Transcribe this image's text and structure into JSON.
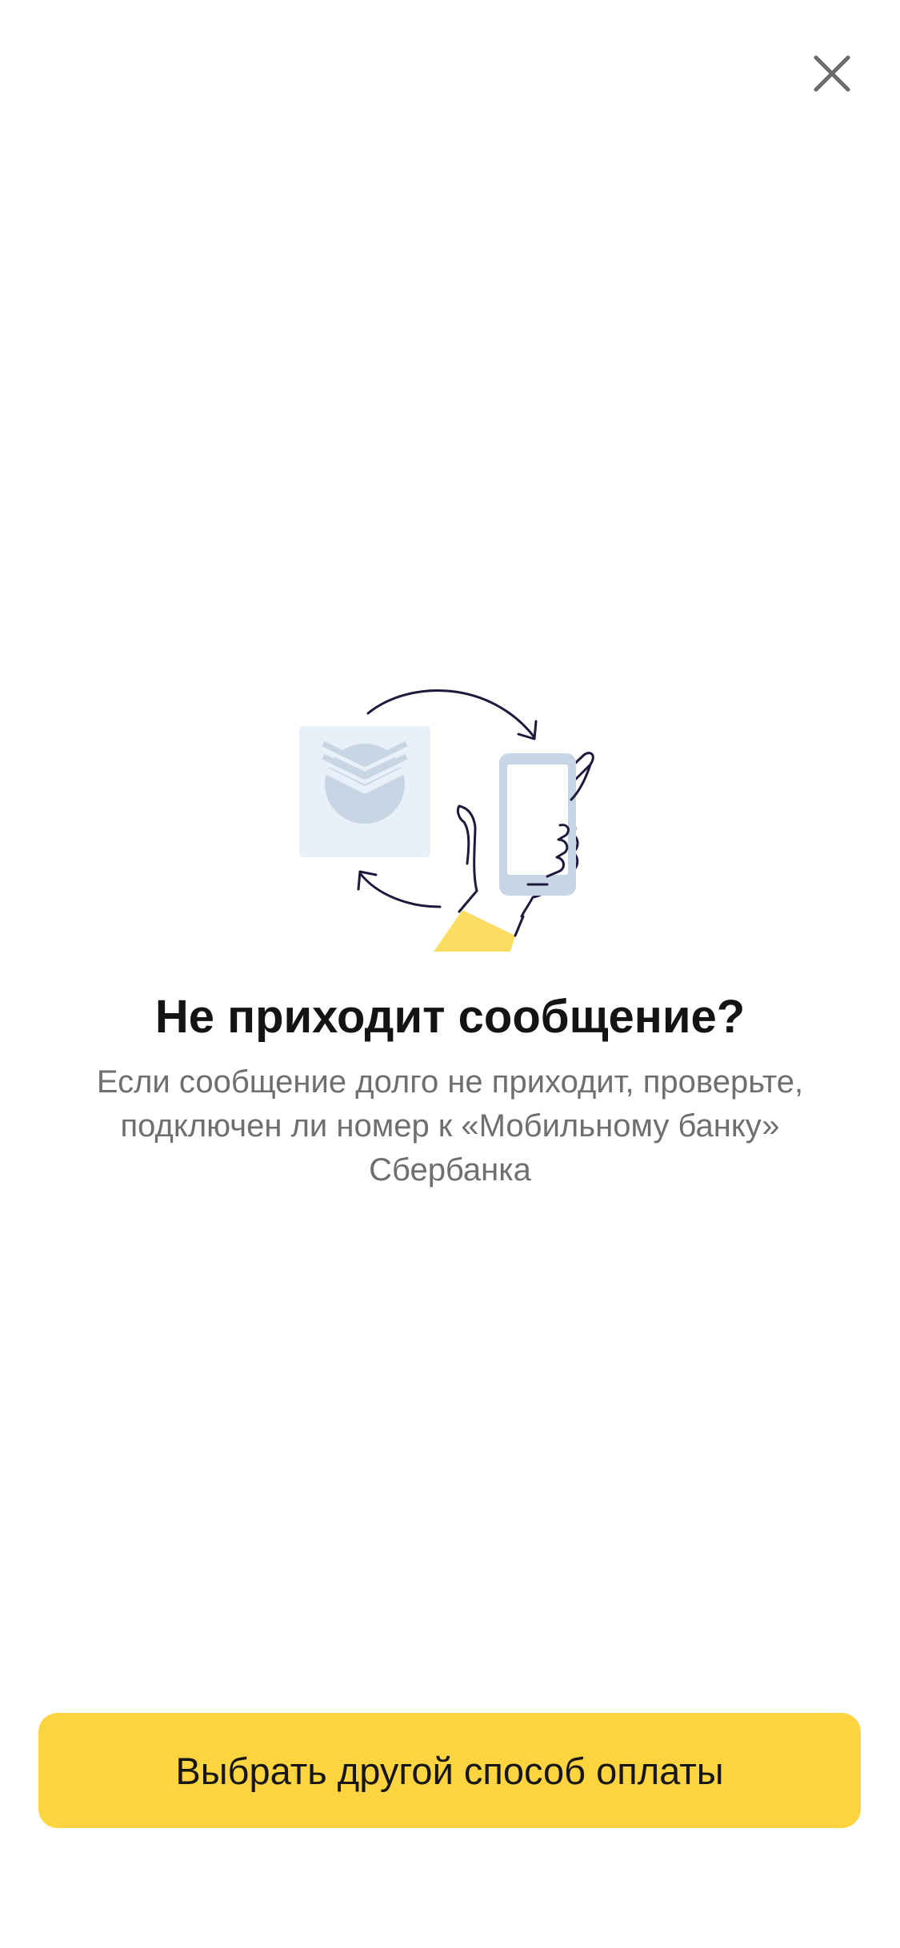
{
  "header": {
    "close_icon": "close-icon"
  },
  "illustration": {
    "icons": [
      "sberbank-logo-icon",
      "phone-in-hand-icon",
      "refresh-arrows-icon"
    ]
  },
  "message": {
    "title": "Не приходит сообщение?",
    "body": "Если сообщение долго не приходит, проверьте, подключен ли номер к «Мобильному банку» Сбербанка"
  },
  "footer": {
    "primary_button_label": "Выбрать другой способ оплаты"
  },
  "colors": {
    "accent": "#fcd43f",
    "title": "#141414",
    "body_text": "#6f6f6f",
    "close_icon": "#6b6b6b"
  }
}
